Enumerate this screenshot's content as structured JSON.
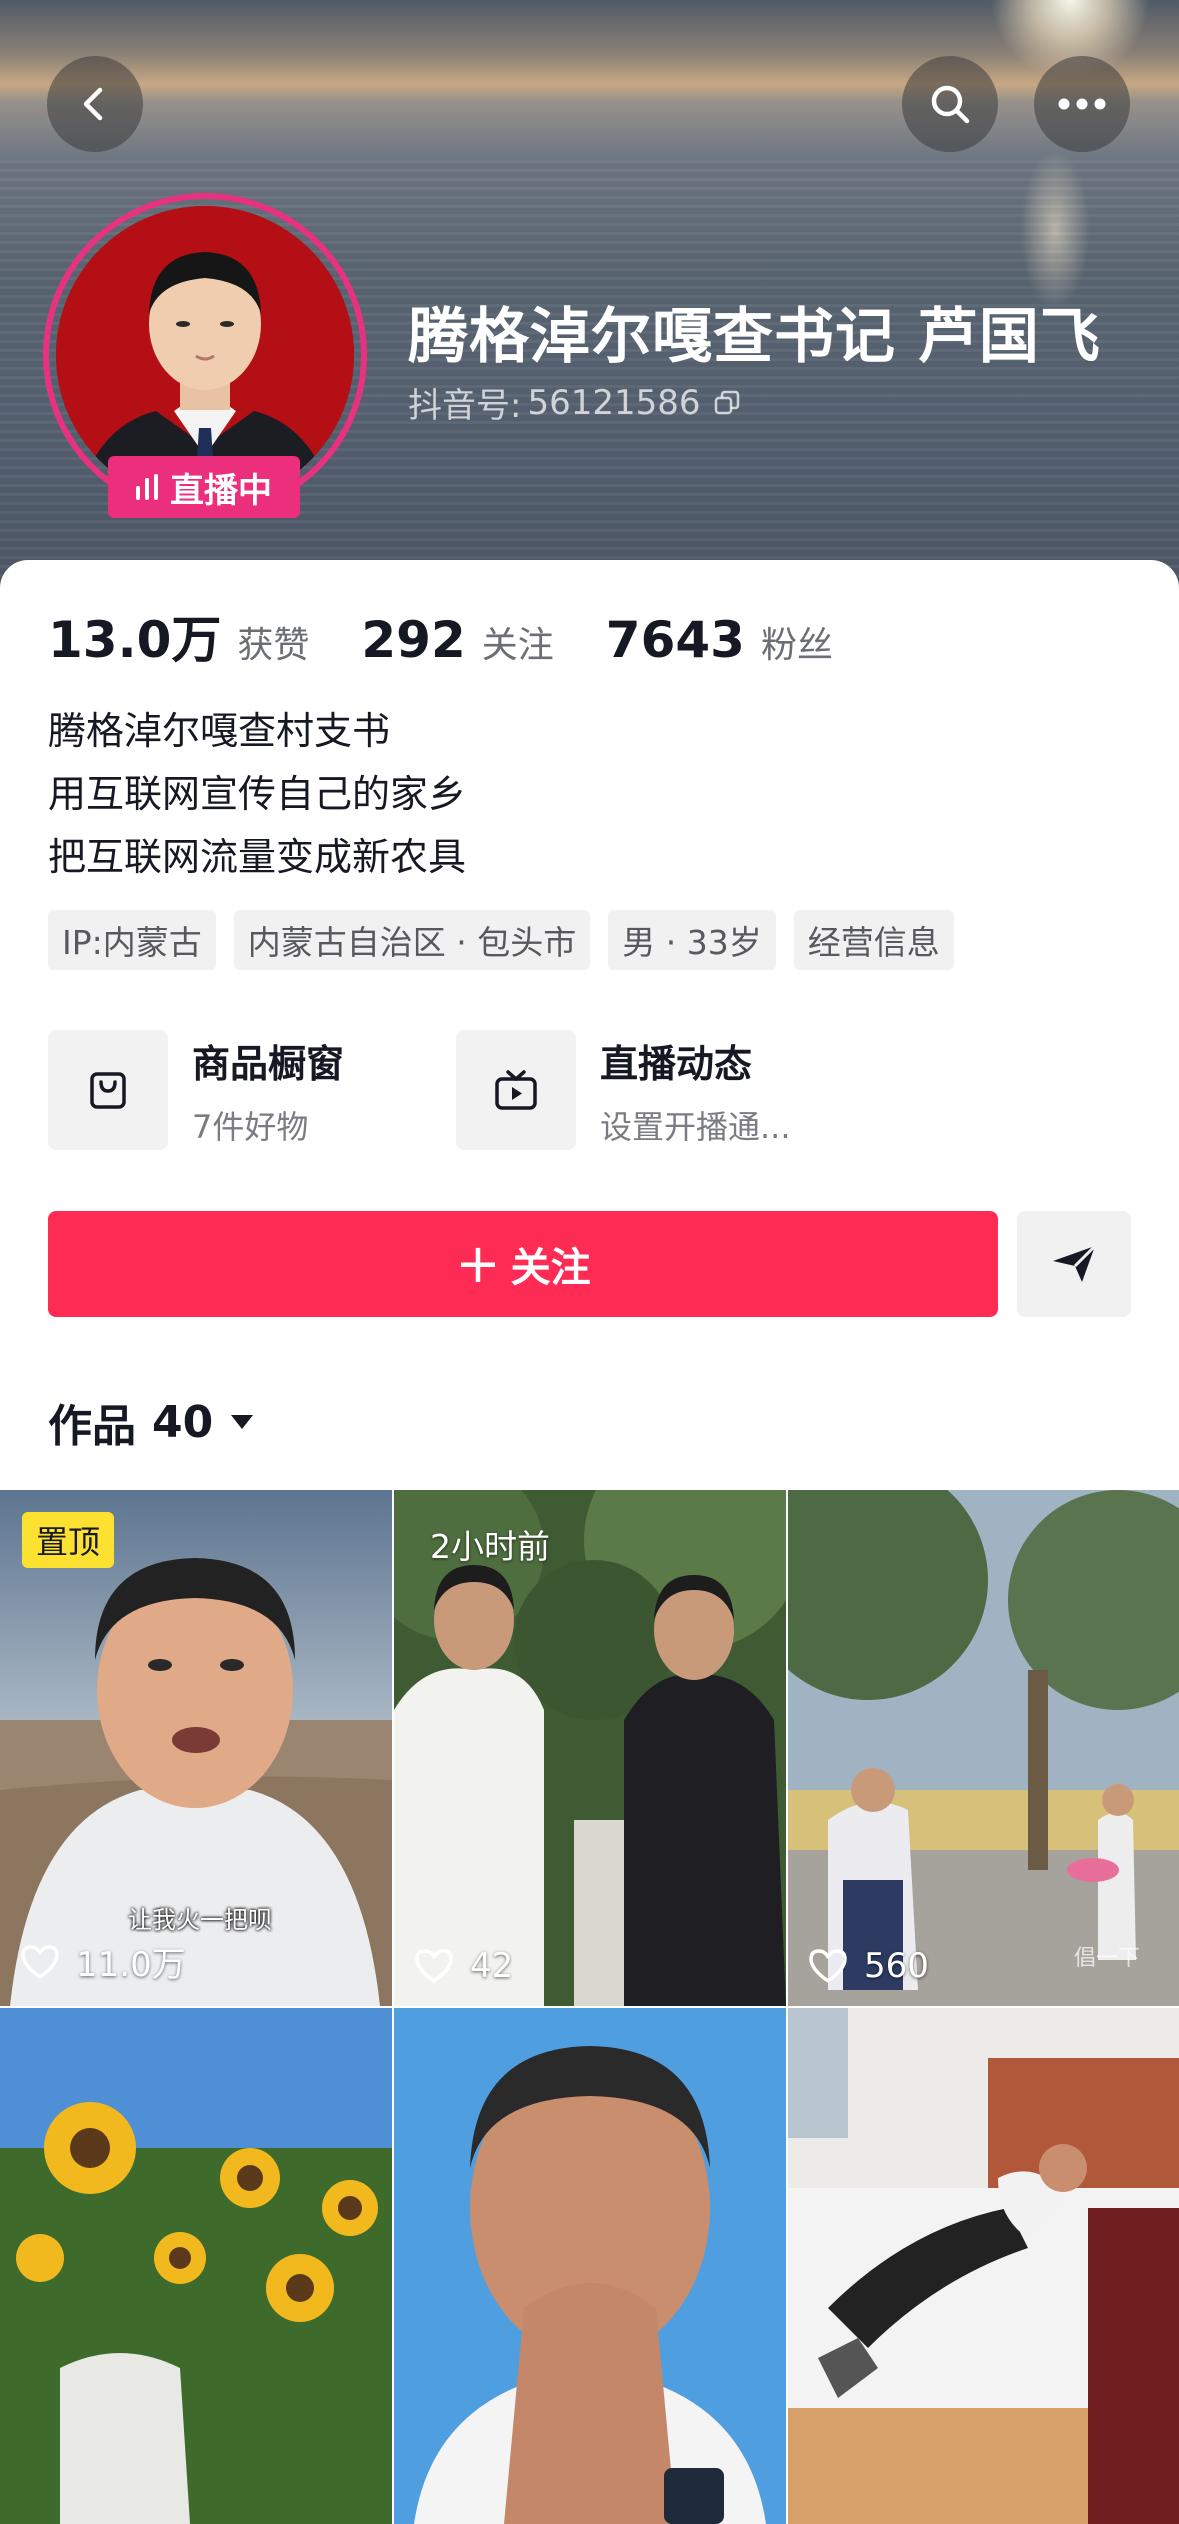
{
  "header": {
    "back_icon": "chevron-left-icon",
    "search_icon": "search-icon",
    "more_icon": "more-horizontal-icon"
  },
  "profile": {
    "name": "腾格淖尔嘎查书记 芦国飞",
    "douyin_id_label": "抖音号:",
    "douyin_id": "56121586",
    "live_badge": "直播中"
  },
  "stats": [
    {
      "value": "13.0万",
      "label": "获赞"
    },
    {
      "value": "292",
      "label": "关注"
    },
    {
      "value": "7643",
      "label": "粉丝"
    }
  ],
  "bio": [
    "腾格淖尔嘎查村支书",
    "用互联网宣传自己的家乡",
    "把互联网流量变成新农具"
  ],
  "tags": [
    "IP:内蒙古",
    "内蒙古自治区 · 包头市",
    "男 · 33岁",
    "经营信息"
  ],
  "features": [
    {
      "title": "商品橱窗",
      "subtitle": "7件好物",
      "icon": "shopping-bag-icon"
    },
    {
      "title": "直播动态",
      "subtitle": "设置开播通...",
      "icon": "tv-icon"
    }
  ],
  "actions": {
    "follow_label": "关注",
    "share_icon": "send-icon"
  },
  "works": {
    "label": "作品",
    "count": "40"
  },
  "videos": [
    {
      "badge": "置顶",
      "likes": "11.0万",
      "subtitle": "让我火一把呗"
    },
    {
      "time": "2小时前",
      "likes": "42"
    },
    {
      "likes": "560",
      "watermark": "倡一下"
    },
    {},
    {},
    {}
  ],
  "colors": {
    "accent": "#fe2c55",
    "live": "#ec2f7c",
    "pin_badge": "#fce131"
  }
}
